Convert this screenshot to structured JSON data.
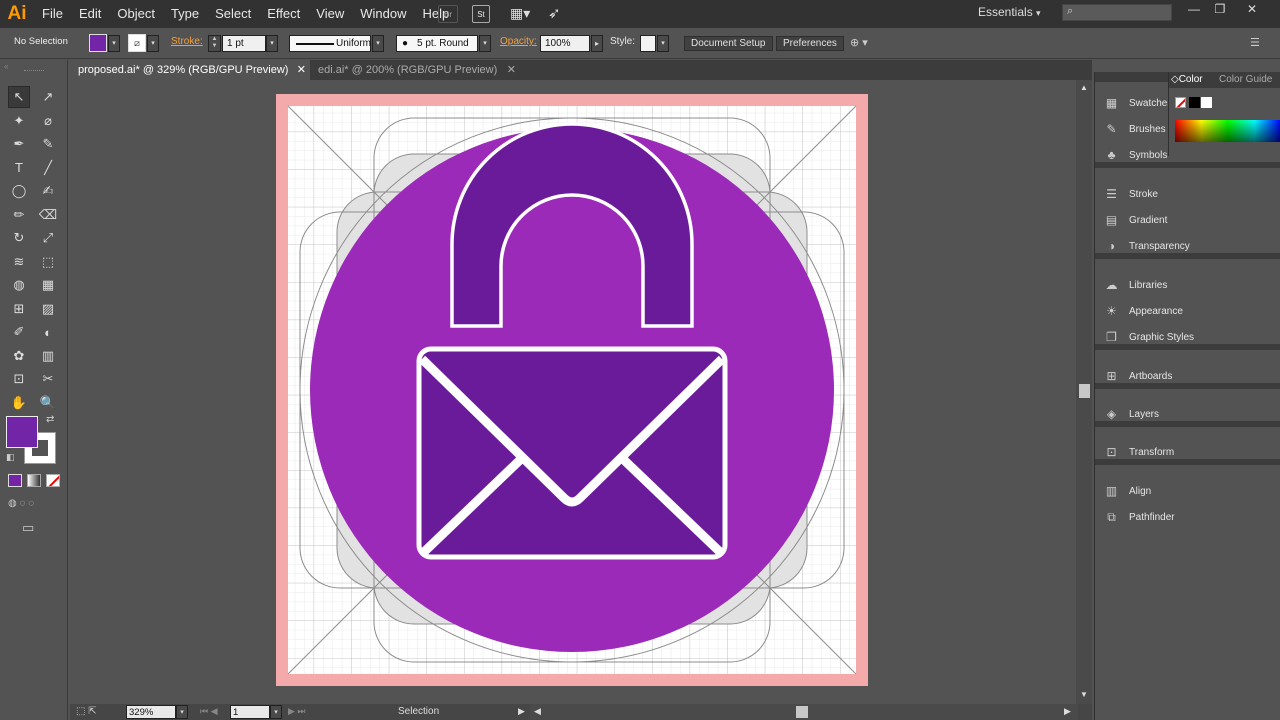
{
  "app": {
    "logo": "Ai"
  },
  "menu": [
    "File",
    "Edit",
    "Object",
    "Type",
    "Select",
    "Effect",
    "View",
    "Window",
    "Help"
  ],
  "menubar_buttons": [
    "Br",
    "St"
  ],
  "workspace": {
    "label": "Essentials",
    "arrow": "▾"
  },
  "window_controls": [
    "—",
    "❐",
    "✕"
  ],
  "control": {
    "selection": "No Selection",
    "fill_color": "#7325a8",
    "stroke_label": "Stroke:",
    "stroke_weight": "1 pt",
    "profile": "Uniform",
    "brush": "5 pt. Round",
    "opacity_label": "Opacity:",
    "opacity": "100%",
    "style_label": "Style:",
    "document_setup": "Document Setup",
    "preferences": "Preferences"
  },
  "tabs": [
    {
      "label": "proposed.ai* @ 329% (RGB/GPU Preview)",
      "active": true
    },
    {
      "label": "edi.ai* @ 200% (RGB/GPU Preview)",
      "active": false
    }
  ],
  "tools": [
    "selection-tool",
    "direct-selection-tool",
    "magic-wand-tool",
    "lasso-tool",
    "pen-tool",
    "curvature-tool",
    "type-tool",
    "line-tool",
    "ellipse-tool",
    "paintbrush-tool",
    "pencil-tool",
    "eraser-tool",
    "rotate-tool",
    "scale-tool",
    "warp-tool",
    "free-transform-tool",
    "shape-builder-tool",
    "perspective-grid-tool",
    "mesh-tool",
    "gradient-tool",
    "eyedropper-tool",
    "blend-tool",
    "symbol-sprayer-tool",
    "column-graph-tool",
    "artboard-tool",
    "slice-tool",
    "hand-tool",
    "zoom-tool"
  ],
  "tool_glyphs": [
    "↖",
    "↗",
    "✦",
    "⌀",
    "✒",
    "✎",
    "T",
    "╱",
    "◯",
    "✍",
    "✏",
    "⌫",
    "↻",
    "⤢",
    "≋",
    "⬚",
    "◍",
    "▦",
    "⊞",
    "▨",
    "✐",
    "◐",
    "✿",
    "▥",
    "⊡",
    "✂",
    "✋",
    "🔍"
  ],
  "colors": {
    "fill": "#7325a8",
    "circle": "#9b2ab8",
    "lock": "#6a1b9a",
    "bleed": "#f4aaaa",
    "grid": "#cfcfcf"
  },
  "status": {
    "zoom": "329%",
    "artboard": "1",
    "tool": "Selection"
  },
  "panels": [
    {
      "label": "Swatches",
      "icon": "swatches-icon",
      "glyph": "▦"
    },
    {
      "label": "Brushes",
      "icon": "brushes-icon",
      "glyph": "✎"
    },
    {
      "label": "Symbols",
      "icon": "symbols-icon",
      "glyph": "♣"
    },
    {
      "label": "Stroke",
      "icon": "stroke-icon",
      "glyph": "☰"
    },
    {
      "label": "Gradient",
      "icon": "gradient-icon",
      "glyph": "▤"
    },
    {
      "label": "Transparency",
      "icon": "transparency-icon",
      "glyph": "◑"
    },
    {
      "label": "Libraries",
      "icon": "libraries-icon",
      "glyph": "☁"
    },
    {
      "label": "Appearance",
      "icon": "appearance-icon",
      "glyph": "☀"
    },
    {
      "label": "Graphic Styles",
      "icon": "graphic-styles-icon",
      "glyph": "❐"
    },
    {
      "label": "Artboards",
      "icon": "artboards-icon",
      "glyph": "⊞"
    },
    {
      "label": "Layers",
      "icon": "layers-icon",
      "glyph": "◈"
    },
    {
      "label": "Transform",
      "icon": "transform-icon",
      "glyph": "⊡"
    },
    {
      "label": "Align",
      "icon": "align-icon",
      "glyph": "▥"
    },
    {
      "label": "Pathfinder",
      "icon": "pathfinder-icon",
      "glyph": "⧉"
    }
  ],
  "color_panel": {
    "tabs": [
      "Color",
      "Color Guide"
    ]
  }
}
